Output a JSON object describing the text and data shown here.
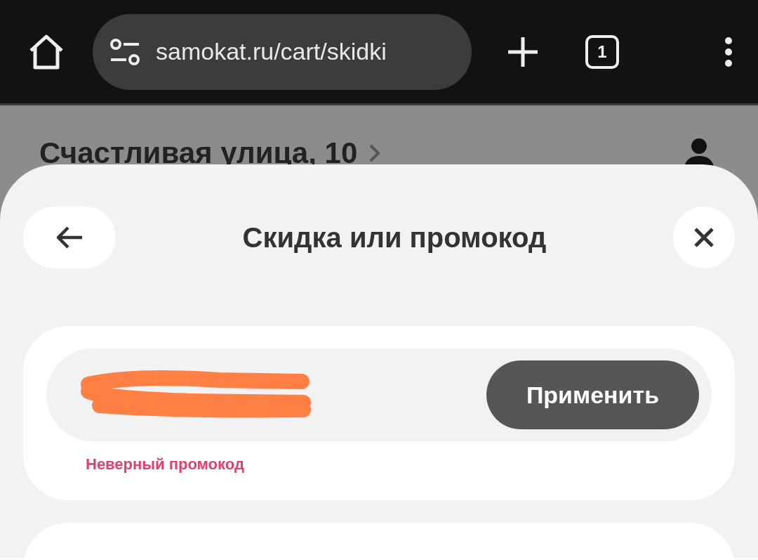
{
  "browser": {
    "url": "samokat.ru/cart/skidki",
    "tab_count": "1"
  },
  "page": {
    "address": "Счастливая улица, 10"
  },
  "sheet": {
    "title": "Скидка или промокод",
    "promo": {
      "redacted": true,
      "apply_label": "Применить",
      "error": "Неверный промокод"
    }
  }
}
